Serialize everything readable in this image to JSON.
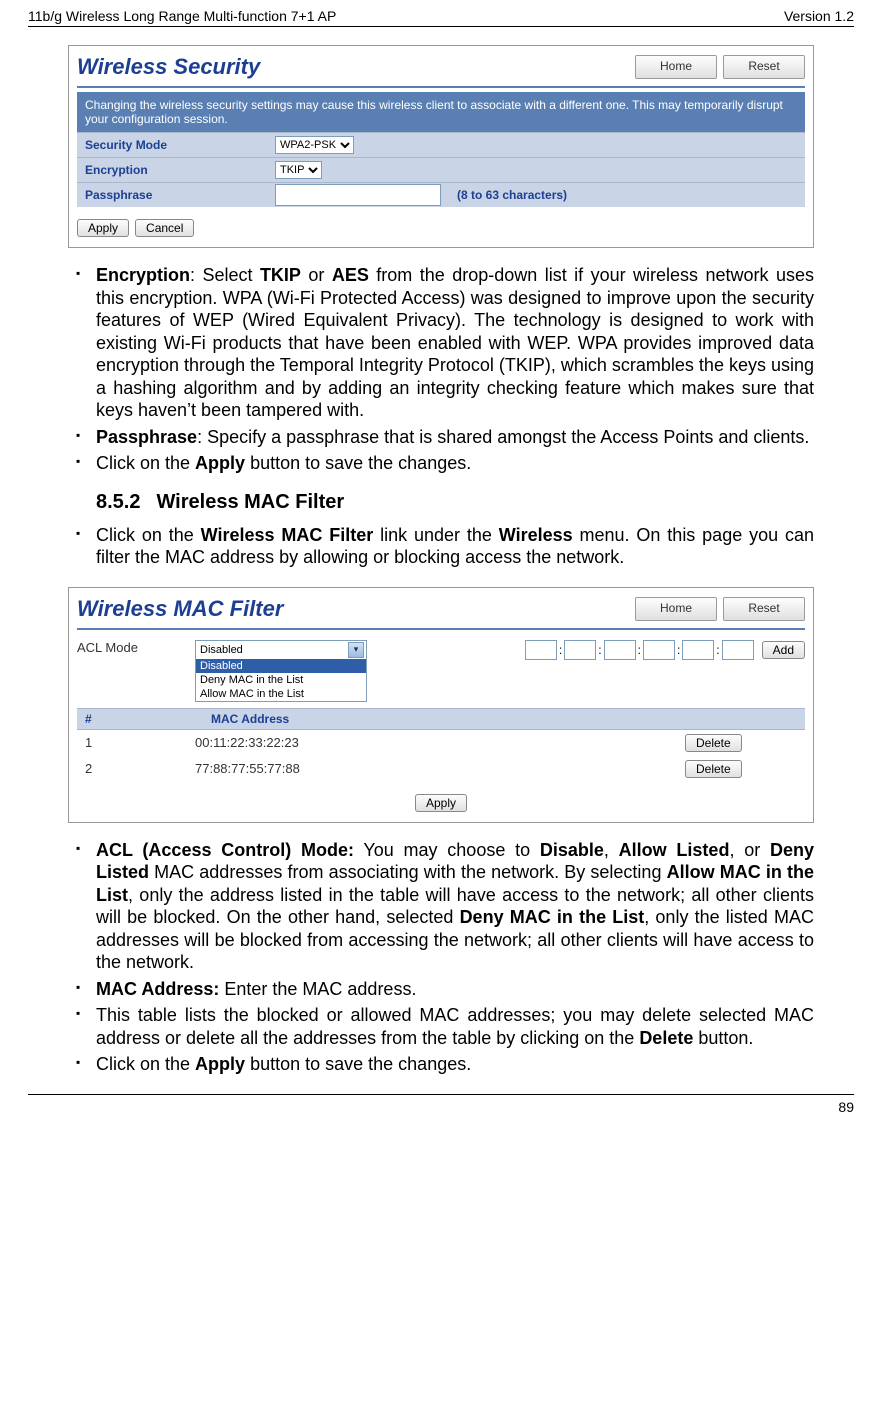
{
  "header": {
    "left": "11b/g Wireless Long Range Multi-function 7+1 AP",
    "right": "Version 1.2"
  },
  "footer": {
    "page": "89"
  },
  "shot1": {
    "title": "Wireless Security",
    "home": "Home",
    "reset": "Reset",
    "banner": "Changing the wireless security settings may cause this wireless client to associate with a different one. This may temporarily disrupt your configuration session.",
    "row_secmode": "Security Mode",
    "sel_secmode": "WPA2-PSK",
    "row_enc": "Encryption",
    "sel_enc": "TKIP",
    "row_pass": "Passphrase",
    "hint_pass": "(8 to 63 characters)",
    "apply": "Apply",
    "cancel": "Cancel"
  },
  "bullets1": {
    "b1_lead": "Encryption",
    "b1_rest": ": Select ",
    "b1_tkip": "TKIP",
    "b1_or": " or ",
    "b1_aes": "AES",
    "b1_tail": " from the drop-down list if your wireless network uses this encryption. WPA (Wi-Fi Protected Access) was designed to improve upon the security features of WEP (Wired Equivalent Privacy). The technology is designed to work with existing Wi-Fi products that have been enabled with WEP. WPA provides improved data encryption through the Temporal Integrity Protocol (TKIP), which scrambles the keys using a hashing algorithm and by adding an integrity checking feature which makes sure that keys haven’t been tampered with.",
    "b2_lead": "Passphrase",
    "b2_tail": ": Specify a passphrase that is shared amongst the Access Points and clients.",
    "b3_pre": "Click on the ",
    "b3_bold": "Apply",
    "b3_post": " button to save the changes."
  },
  "section": {
    "num": "8.5.2",
    "title": "Wireless MAC Filter"
  },
  "bullets2a": {
    "pre": "Click on the ",
    "b1": "Wireless MAC Filter",
    "mid": " link under the ",
    "b2": "Wireless",
    "post": " menu. On this page you can filter the MAC address by allowing or blocking access the network."
  },
  "shot2": {
    "title": "Wireless MAC Filter",
    "home": "Home",
    "reset": "Reset",
    "acl_label": "ACL Mode",
    "sel_shown": "Disabled",
    "opt0": "Disabled",
    "opt1": "Deny MAC in the List",
    "opt2": "Allow MAC in the List",
    "add": "Add",
    "col_num": "#",
    "col_mac": "MAC Address",
    "r1n": "1",
    "r1mac": "00:11:22:33:22:23",
    "r2n": "2",
    "r2mac": "77:88:77:55:77:88",
    "delete": "Delete",
    "apply": "Apply"
  },
  "bullets2b": {
    "b1_lead": "ACL (Access Control) Mode:",
    "b1_a": " You may choose to ",
    "b1_dis": "Disable",
    "b1_b": ", ",
    "b1_allow": "Allow Listed",
    "b1_c": ", or ",
    "b1_deny": "Deny Listed",
    "b1_d": " MAC addresses from associating with the network. By selecting ",
    "b1_allowmac": "Allow MAC in the List",
    "b1_e": ", only the address listed in the table will have access to the network; all other clients will be blocked. On the other hand, selected ",
    "b1_denymac": "Deny MAC in the List",
    "b1_f": ", only the listed MAC addresses will be blocked from accessing the network; all other clients will have access to the network.",
    "b2_lead": "MAC Address:",
    "b2_tail": " Enter the MAC address.",
    "b3_pre": "This table lists the blocked or allowed MAC addresses; you may delete selected MAC address or delete all the addresses from the table by clicking on the ",
    "b3_bold": "Delete",
    "b3_post": " button.",
    "b4_pre": "Click on the ",
    "b4_bold": "Apply",
    "b4_post": " button to save the changes."
  }
}
